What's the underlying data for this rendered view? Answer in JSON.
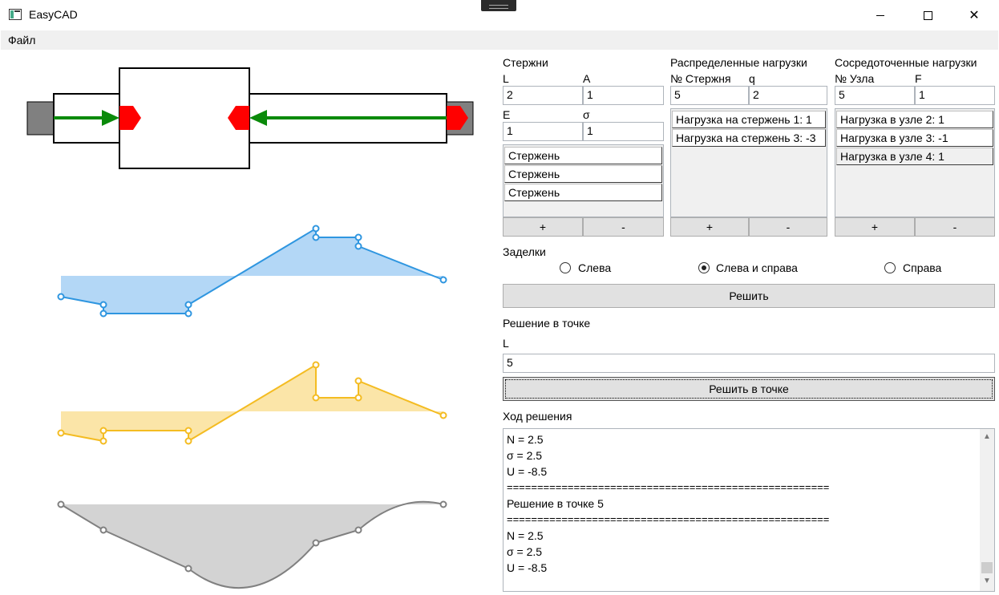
{
  "window": {
    "title": "EasyCAD"
  },
  "menu": {
    "file": "Файл"
  },
  "rods": {
    "title": "Стержни",
    "l_label": "L",
    "a_label": "A",
    "l_value": "2",
    "a_value": "1",
    "e_label": "E",
    "s_label": "σ",
    "e_value": "1",
    "s_value": "1",
    "items": [
      "Стержень",
      "Стержень",
      "Стержень"
    ],
    "add": "+",
    "remove": "-"
  },
  "dist_loads": {
    "title": "Распределенные нагрузки",
    "rod_label": "№ Стержня",
    "q_label": "q",
    "rod_value": "5",
    "q_value": "2",
    "items": [
      "Нагрузка на стержень 1: 1",
      "Нагрузка на стержень 3: -3"
    ],
    "add": "+",
    "remove": "-"
  },
  "point_loads": {
    "title": "Сосредоточенные нагрузки",
    "node_label": "№ Узла",
    "f_label": "F",
    "node_value": "5",
    "f_value": "1",
    "items": [
      "Нагрузка в узле 2: 1",
      "Нагрузка в узле 3: -1",
      "Нагрузка в узле 4: 1"
    ],
    "add": "+",
    "remove": "-"
  },
  "supports": {
    "title": "Заделки",
    "left": "Слева",
    "both": "Слева и справа",
    "right": "Справа",
    "selected": "both"
  },
  "solve_button": "Решить",
  "point_solution": {
    "title": "Решение в точке",
    "l_label": "L",
    "l_value": "5",
    "button": "Решить в точке"
  },
  "log": {
    "title": "Ход решения",
    "lines": [
      "N = 2.5",
      "σ = 2.5",
      "U = -8.5",
      "=====================================================",
      "Решение в точке 5",
      "=====================================================",
      "N = 2.5",
      "σ = 2.5",
      "U = -8.5"
    ]
  },
  "colors": {
    "chart_n": "#2f96e0",
    "chart_n_fill": "#b3d7f6",
    "chart_s": "#f4bc22",
    "chart_s_fill": "#fbe5a8",
    "chart_u": "#808080",
    "chart_u_fill": "#d3d3d3",
    "arrow": "#0a8a0a",
    "support": "#ff0000"
  }
}
